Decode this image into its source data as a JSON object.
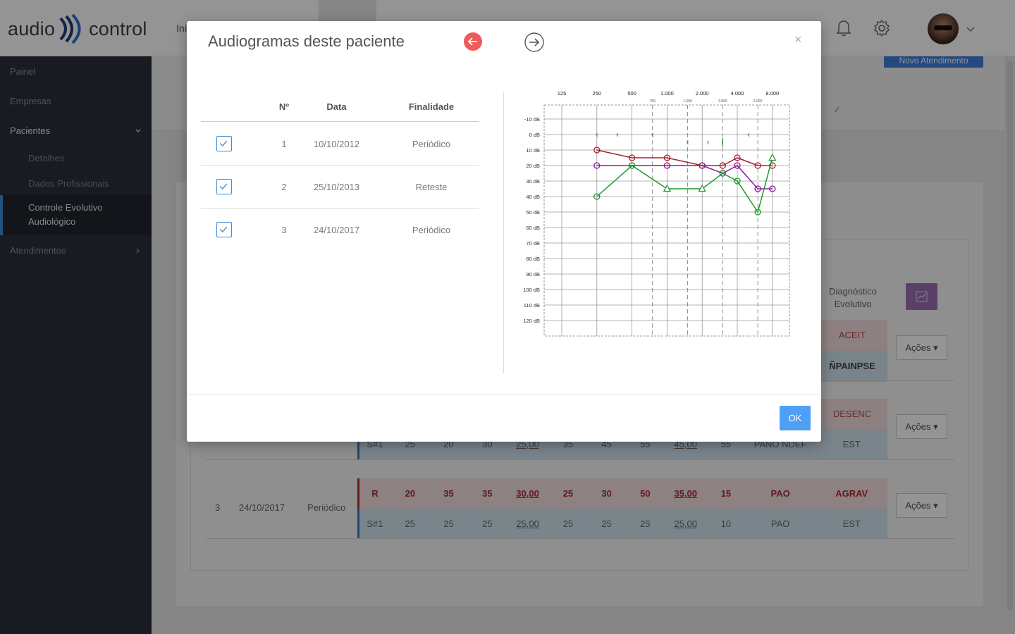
{
  "app": {
    "logo_left": "audio",
    "logo_right": "control",
    "nav_first": "Iní"
  },
  "sidebar": {
    "items": [
      {
        "label": "Painel"
      },
      {
        "label": "Empresas"
      },
      {
        "label": "Pacientes"
      },
      {
        "label": "Atendimentos"
      }
    ],
    "subitems": [
      {
        "label": "Detalhes"
      },
      {
        "label": "Dados Profissionais"
      },
      {
        "label": "Controle Evolutivo Audiológico"
      }
    ]
  },
  "background": {
    "novo_button": "Novo Atendimento",
    "diagnostico_label": "Diagnóstico Evolutivo",
    "acoes_label": "Ações ▾",
    "statuses": [
      "ACEIT",
      "ÑPAINPSE",
      "DESENC",
      "EST",
      "AGRAV",
      "EST"
    ],
    "row2_side": [
      "S#1",
      "25",
      "20",
      "30",
      "25,00",
      "35",
      "45",
      "55",
      "45,00",
      "55",
      "PANO NDEF"
    ],
    "row3": {
      "num": "3",
      "date": "24/10/2017",
      "finalidade": "Periódico",
      "red": [
        "R",
        "20",
        "35",
        "35",
        "30,00",
        "25",
        "30",
        "50",
        "35,00",
        "15",
        "PAO"
      ],
      "blue": [
        "S#1",
        "25",
        "25",
        "25",
        "25,00",
        "25",
        "25",
        "25",
        "25,00",
        "10",
        "PAO"
      ]
    }
  },
  "modal": {
    "title": "Audiogramas deste paciente",
    "ok_label": "OK",
    "close_label": "×",
    "columns": [
      "Nº",
      "Data",
      "Finalidade"
    ],
    "rows": [
      {
        "num": "1",
        "date": "10/10/2012",
        "finalidade": "Periódico"
      },
      {
        "num": "2",
        "date": "25/10/2013",
        "finalidade": "Reteste"
      },
      {
        "num": "3",
        "date": "24/10/2017",
        "finalidade": "Periódico"
      }
    ]
  },
  "chart_data": {
    "type": "line",
    "freq_labels_top": [
      "125",
      "250",
      "500",
      "1.000",
      "2.000",
      "4.000",
      "8.000"
    ],
    "freq_labels_mid": [
      "750",
      "1.500",
      "3.000",
      "6.000"
    ],
    "db_labels": [
      "-10 dB",
      "0 dB",
      "10 dB",
      "20 dB",
      "30 dB",
      "40 dB",
      "50 dB",
      "60 dB",
      "70 dB",
      "80 dB",
      "90 dB",
      "100 dB",
      "110 dB",
      "120 dB"
    ],
    "x": [
      250,
      500,
      1000,
      2000,
      3000,
      4000,
      6000,
      8000
    ],
    "ylim": [
      -10,
      120
    ],
    "series": [
      {
        "color": "#a8202e",
        "marker": "circle",
        "values": [
          10,
          15,
          15,
          20,
          20,
          15,
          20,
          20
        ]
      },
      {
        "color": "#8e1aa0",
        "marker": "circle",
        "values": [
          20,
          20,
          20,
          20,
          25,
          20,
          35,
          35
        ]
      },
      {
        "color": "#1f9a2c",
        "marker": "mixed",
        "markers": [
          "circle",
          "circle",
          "triangle",
          "triangle",
          "circle",
          "circle",
          "circle",
          "triangle"
        ],
        "values": [
          40,
          20,
          35,
          35,
          25,
          30,
          50,
          15
        ]
      }
    ],
    "bone_markers": [
      {
        "freq": 250,
        "db": 0,
        "symbol": "‹"
      },
      {
        "freq": 375,
        "db": 0,
        "symbol": "‹"
      },
      {
        "freq": 750,
        "db": 0,
        "symbol": "‹"
      },
      {
        "freq": 1500,
        "db": 5,
        "symbol": "‹"
      },
      {
        "freq": 2250,
        "db": 5,
        "symbol": "‹"
      },
      {
        "freq": 3000,
        "db": 5,
        "symbol": "["
      },
      {
        "freq": 5000,
        "db": 0,
        "symbol": "‹"
      }
    ]
  }
}
